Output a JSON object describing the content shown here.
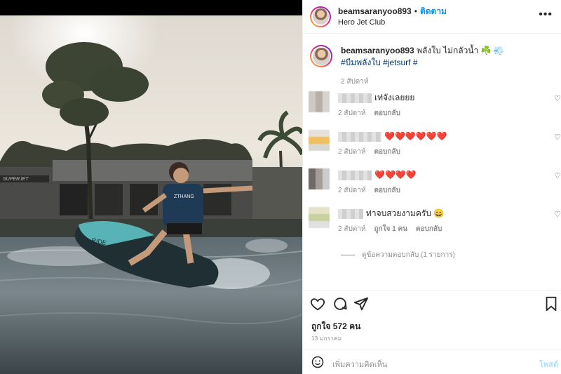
{
  "post": {
    "username": "beamsaranyoo893",
    "follow_label": "ติดตาม",
    "location": "Hero Jet Club",
    "caption_text": "พลังใบ ไม่กลัวน้ำ ☘️ 💨",
    "caption_tags": "#บีมพลังใบ #jetsurf #",
    "caption_time": "2 สัปดาห์"
  },
  "comments": [
    {
      "text": "เท่จังเลยยย",
      "time": "2 สัปดาห์",
      "reply": "ตอบกลับ",
      "likes": ""
    },
    {
      "text": "❤️❤️❤️❤️❤️❤️",
      "time": "2 สัปดาห์",
      "reply": "ตอบกลับ",
      "likes": ""
    },
    {
      "text": "❤️❤️❤️❤️",
      "time": "2 สัปดาห์",
      "reply": "ตอบกลับ",
      "likes": ""
    },
    {
      "text": "ท่าจบสวยงามครับ 😄",
      "time": "2 สัปดาห์",
      "reply": "ตอบกลับ",
      "likes": "ถูกใจ 1 คน"
    }
  ],
  "view_replies": "ดูข้อความตอบกลับ (1 รายการ)",
  "likes_count": "ถูกใจ 572 คน",
  "post_date": "13 มกราคม",
  "add_comment_placeholder": "เพิ่มความคิดเห็น",
  "post_button": "โพสต์",
  "photo_sign": "SUPERJET",
  "vest_text": "ZTHANG"
}
